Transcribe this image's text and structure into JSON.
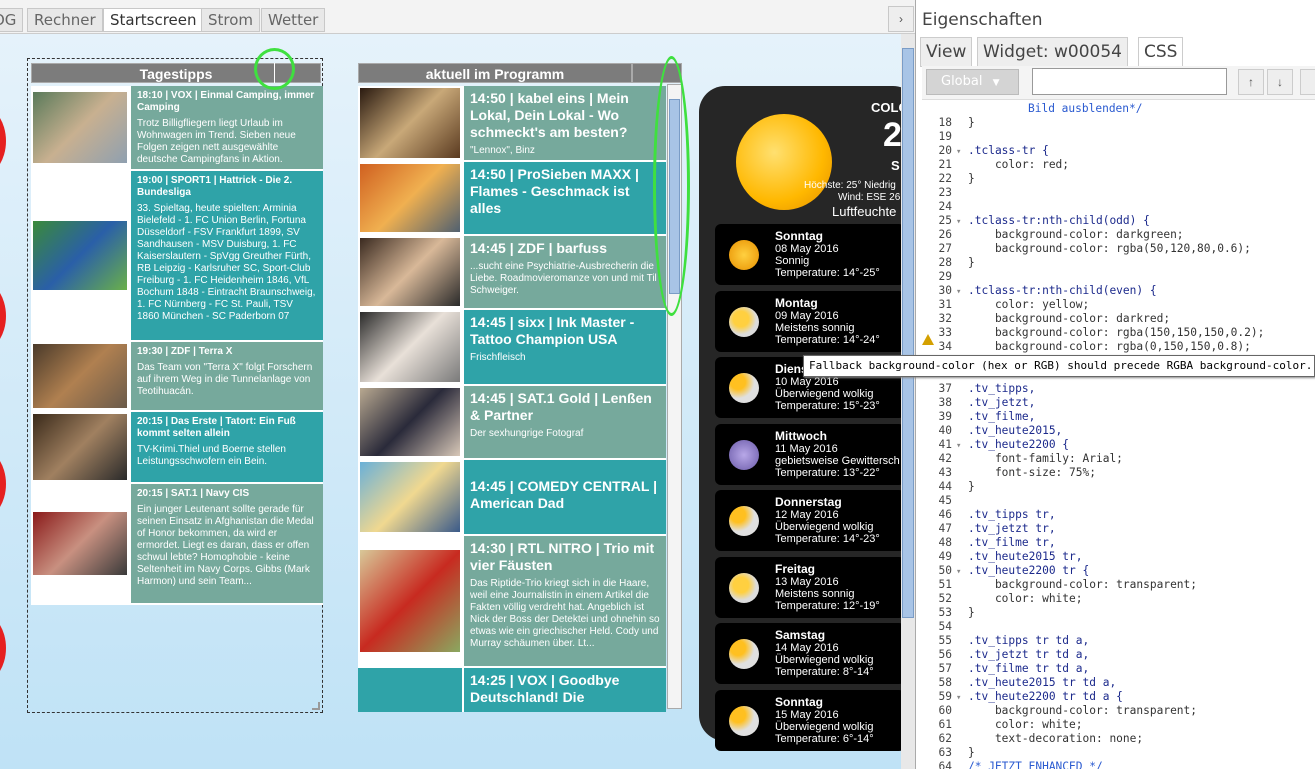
{
  "view_tabs": [
    "OG",
    "Rechner",
    "Startscreen",
    "Strom",
    "Wetter"
  ],
  "tab_arrow": "›",
  "tagestipps": {
    "title": "Tagestipps",
    "items": [
      {
        "head": "18:10 | VOX | Einmal Camping, immer Camping",
        "desc": "Trotz Billigfliegern liegt Urlaub im Wohnwagen im Trend. Sieben neue Folgen zeigen nett ausgewählte deutsche Campingfans in Aktion."
      },
      {
        "head": "19:00 | SPORT1 | Hattrick - Die 2. Bundesliga",
        "desc": "33. Spieltag, heute spielten: Arminia Bielefeld - 1. FC Union Berlin, Fortuna Düsseldorf - FSV Frankfurt 1899, SV Sandhausen - MSV Duisburg, 1. FC Kaiserslautern - SpVgg Greuther Fürth, RB Leipzig - Karlsruher SC, Sport-Club Freiburg - 1. FC Heidenheim 1846, VfL Bochum 1848 - Eintracht Braunschweig, 1. FC Nürnberg - FC St. Pauli, TSV 1860 München - SC Paderborn 07"
      },
      {
        "head": "19:30 | ZDF | Terra X",
        "desc": "Das Team von \"Terra X\" folgt Forschern auf ihrem Weg in die Tunnelanlage von Teotihuacán."
      },
      {
        "head": "20:15 | Das Erste | Tatort: Ein Fuß kommt selten allein",
        "desc": "TV-Krimi.Thiel und Boerne stellen Leistungsschwofern ein Bein."
      },
      {
        "head": "20:15 | SAT.1 | Navy CIS",
        "desc": "Ein junger Leutenant sollte gerade für seinen Einsatz in Afghanistan die Medal of Honor bekommen, da wird er ermordet. Liegt es daran, dass er offen schwul lebte? Homophobie - keine Seltenheit im Navy Corps. Gibbs (Mark Harmon) und sein Team..."
      }
    ]
  },
  "programm": {
    "title": "aktuell im Programm",
    "items": [
      {
        "head": "14:50 | kabel eins | Mein Lokal, Dein Lokal - Wo schmeckt's am besten?",
        "desc": "\"Lennox\", Binz"
      },
      {
        "head": "14:50 | ProSieben MAXX | Flames - Geschmack ist alles",
        "desc": ""
      },
      {
        "head": "14:45 | ZDF | barfuss",
        "desc": "...sucht eine Psychiatrie-Ausbrecherin die Liebe. Roadmovieromanze von und mit Til Schweiger."
      },
      {
        "head": "14:45 | sixx | Ink Master - Tattoo Champion USA",
        "desc": "Frischfleisch"
      },
      {
        "head": "14:45 | SAT.1 Gold | Lenßen & Partner",
        "desc": "Der sexhungrige Fotograf"
      },
      {
        "head": "14:45 | COMEDY CENTRAL | American Dad",
        "desc": ""
      },
      {
        "head": "14:30 | RTL NITRO | Trio mit vier Fäusten",
        "desc": "Das Riptide-Trio kriegt sich in die Haare, weil eine Journalistin in einem Artikel die Fakten völlig verdreht hat. Angeblich ist Nick der Boss der Detektei und ohnehin so etwas wie ein griechischer Held. Cody und Murray schäumen über. Lt..."
      },
      {
        "head": "14:25 | VOX | Goodbye Deutschland! Die",
        "desc": ""
      }
    ]
  },
  "weather": {
    "city": "COLO",
    "temp": "2",
    "cond": "S",
    "hilo": "Höchste: 25° Niedrig",
    "wind": "Wind: ESE 26",
    "humidity": "Luftfeuchte",
    "days": [
      {
        "day": "Sonntag",
        "date": "08 May 2016",
        "cond": "Sonnig",
        "temp": "Temperature: 14°-25°",
        "icon": "sun"
      },
      {
        "day": "Montag",
        "date": "09 May 2016",
        "cond": "Meistens sonnig",
        "temp": "Temperature: 14°-24°",
        "icon": "partly-sunny"
      },
      {
        "day": "Diens",
        "date": "10 May 2016",
        "cond": "Überwiegend wolkig",
        "temp": "Temperature: 15°-23°",
        "icon": "partly-cloudy"
      },
      {
        "day": "Mittwoch",
        "date": "11 May 2016",
        "cond": "gebietsweise Gewittersch",
        "temp": "Temperature: 13°-22°",
        "icon": "thunderstorm"
      },
      {
        "day": "Donnerstag",
        "date": "12 May 2016",
        "cond": "Überwiegend wolkig",
        "temp": "Temperature: 14°-23°",
        "icon": "partly-cloudy"
      },
      {
        "day": "Freitag",
        "date": "13 May 2016",
        "cond": "Meistens sonnig",
        "temp": "Temperature: 12°-19°",
        "icon": "partly-sunny"
      },
      {
        "day": "Samstag",
        "date": "14 May 2016",
        "cond": "Überwiegend wolkig",
        "temp": "Temperature: 8°-14°",
        "icon": "partly-cloudy"
      },
      {
        "day": "Sonntag",
        "date": "15 May 2016",
        "cond": "Überwiegend wolkig",
        "temp": "Temperature: 6°-14°",
        "icon": "partly-cloudy"
      }
    ]
  },
  "panel": {
    "title": "Eigenschaften",
    "tabs": [
      "View",
      "Widget: w00054",
      "CSS"
    ],
    "scope": "Global",
    "scope_arrow": "▼",
    "search_value": "",
    "up": "↑",
    "down": "↓",
    "tooltip": "Fallback background-color (hex or RGB) should precede RGBA background-color.",
    "code": [
      {
        "n": "",
        "t": "Bild ausblenden*/",
        "k": "cm"
      },
      {
        "n": "18",
        "t": "}"
      },
      {
        "n": "19",
        "t": ""
      },
      {
        "n": "20",
        "f": "▾",
        "t": ".tclass-tr {",
        "k": "sel"
      },
      {
        "n": "21",
        "t": "    color: red;"
      },
      {
        "n": "22",
        "t": "}"
      },
      {
        "n": "23",
        "t": ""
      },
      {
        "n": "24",
        "t": ""
      },
      {
        "n": "25",
        "f": "▾",
        "t": ".tclass-tr:nth-child(odd) {",
        "k": "sel"
      },
      {
        "n": "26",
        "t": "    background-color: darkgreen;"
      },
      {
        "n": "27",
        "t": "    background-color: rgba(50,120,80,0.6);"
      },
      {
        "n": "28",
        "t": "}"
      },
      {
        "n": "29",
        "t": ""
      },
      {
        "n": "30",
        "f": "▾",
        "t": ".tclass-tr:nth-child(even) {",
        "k": "sel"
      },
      {
        "n": "31",
        "t": "    color: yellow;"
      },
      {
        "n": "32",
        "t": "    background-color: darkred;"
      },
      {
        "n": "33",
        "t": "    background-color: rgba(150,150,150,0.2);"
      },
      {
        "n": "34",
        "t": "    background-color: rgba(0,150,150,0.8);"
      },
      {
        "n": "",
        "t": "}"
      },
      {
        "n": "",
        "t": ""
      },
      {
        "n": "37",
        "t": ".tv_tipps,",
        "k": "sel"
      },
      {
        "n": "38",
        "t": ".tv_jetzt,",
        "k": "sel"
      },
      {
        "n": "39",
        "t": ".tv_filme,",
        "k": "sel"
      },
      {
        "n": "40",
        "t": ".tv_heute2015,",
        "k": "sel"
      },
      {
        "n": "41",
        "f": "▾",
        "t": ".tv_heute2200 {",
        "k": "sel"
      },
      {
        "n": "42",
        "t": "    font-family: Arial;"
      },
      {
        "n": "43",
        "t": "    font-size: 75%;"
      },
      {
        "n": "44",
        "t": "}"
      },
      {
        "n": "45",
        "t": ""
      },
      {
        "n": "46",
        "t": ".tv_tipps tr,",
        "k": "sel"
      },
      {
        "n": "47",
        "t": ".tv_jetzt tr,",
        "k": "sel"
      },
      {
        "n": "48",
        "t": ".tv_filme tr,",
        "k": "sel"
      },
      {
        "n": "49",
        "t": ".tv_heute2015 tr,",
        "k": "sel"
      },
      {
        "n": "50",
        "f": "▾",
        "t": ".tv_heute2200 tr {",
        "k": "sel"
      },
      {
        "n": "51",
        "t": "    background-color: transparent;"
      },
      {
        "n": "52",
        "t": "    color: white;"
      },
      {
        "n": "53",
        "t": "}"
      },
      {
        "n": "54",
        "t": ""
      },
      {
        "n": "55",
        "t": ".tv_tipps tr td a,",
        "k": "sel"
      },
      {
        "n": "56",
        "t": ".tv_jetzt tr td a,",
        "k": "sel"
      },
      {
        "n": "57",
        "t": ".tv_filme tr td a,",
        "k": "sel"
      },
      {
        "n": "58",
        "t": ".tv_heute2015 tr td a,",
        "k": "sel"
      },
      {
        "n": "59",
        "f": "▾",
        "t": ".tv_heute2200 tr td a {",
        "k": "sel"
      },
      {
        "n": "60",
        "t": "    background-color: transparent;"
      },
      {
        "n": "61",
        "t": "    color: white;"
      },
      {
        "n": "62",
        "t": "    text-decoration: none;"
      },
      {
        "n": "63",
        "t": "}"
      },
      {
        "n": "64",
        "t": "/* JETZT ENHANCED */",
        "k": "cm"
      }
    ]
  }
}
